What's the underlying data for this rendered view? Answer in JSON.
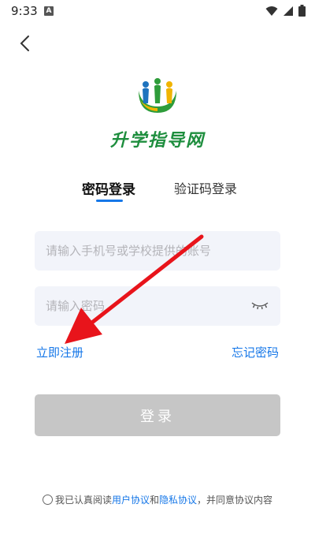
{
  "status_bar": {
    "time": "9:33",
    "notification_letter": "A"
  },
  "logo": {
    "text": "升学指导网"
  },
  "tabs": [
    {
      "label": "密码登录",
      "active": true
    },
    {
      "label": "验证码登录",
      "active": false
    }
  ],
  "form": {
    "account_placeholder": "请输入手机号或学校提供的账号",
    "password_placeholder": "请输入密码"
  },
  "links": {
    "register": "立即注册",
    "forgot": "忘记密码"
  },
  "login_button": {
    "label": "登录"
  },
  "agreement": {
    "prefix": "我已认真阅读",
    "user_agreement": "用户协议",
    "and": "和",
    "privacy_agreement": "隐私协议",
    "suffix": "，并同意协议内容"
  },
  "colors": {
    "accent": "#1677e8",
    "arrow": "#e8141b",
    "disabled_button": "#c6c6c6",
    "input_bg": "#f2f4fa"
  }
}
